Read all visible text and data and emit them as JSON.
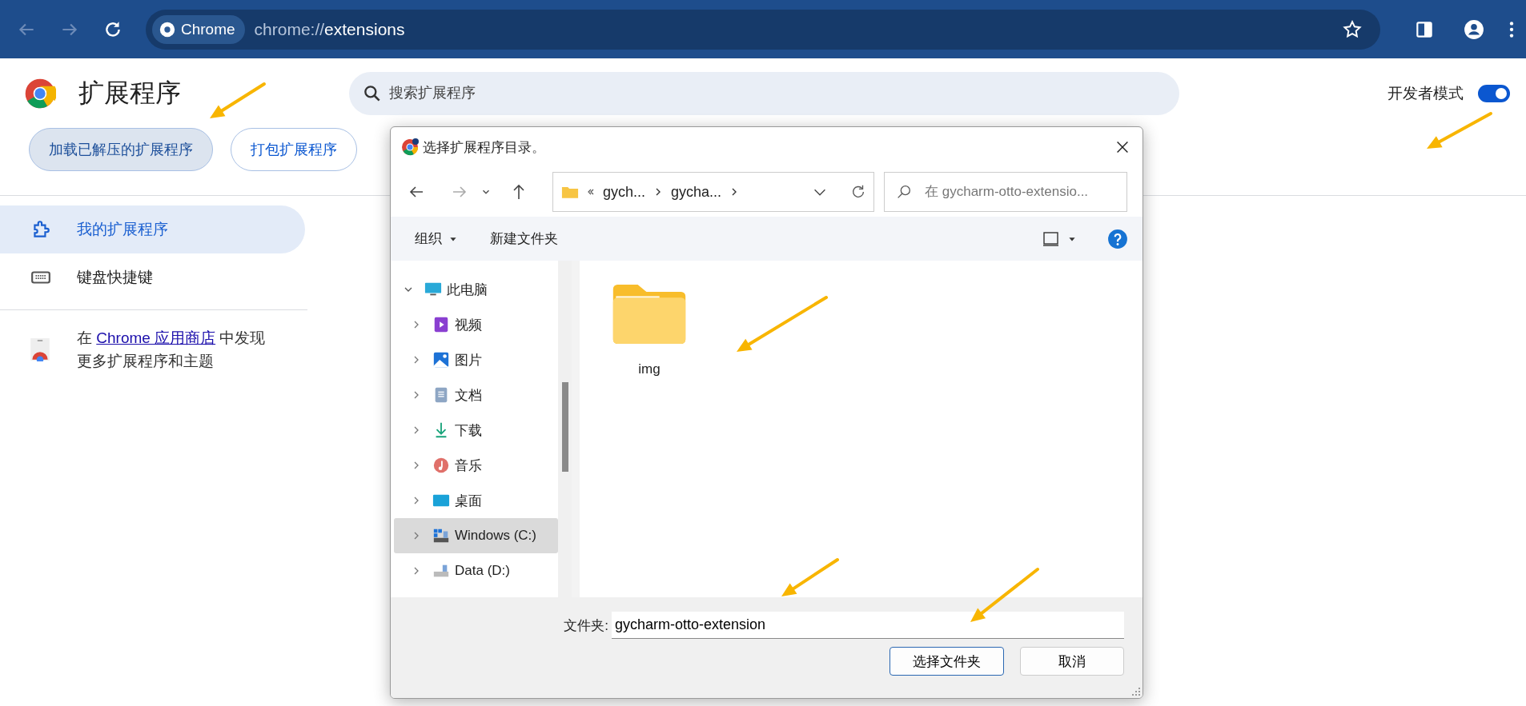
{
  "browser": {
    "back_disabled": true,
    "forward_disabled": true,
    "chip_label": "Chrome",
    "url_scheme": "chrome://",
    "url_path": "extensions"
  },
  "header": {
    "title": "扩展程序",
    "search": {
      "placeholder": "搜索扩展程序"
    },
    "developer_mode": {
      "label": "开发者模式",
      "on": true
    }
  },
  "actions": [
    {
      "label": "加载已解压的扩展程序",
      "highlighted": true
    },
    {
      "label": "打包扩展程序",
      "highlighted": false
    }
  ],
  "sidebar": {
    "items": [
      {
        "label": "我的扩展程序",
        "selected": true
      },
      {
        "label": "键盘快捷键",
        "selected": false
      }
    ],
    "store_promo": {
      "text_before": "在",
      "link": "Chrome 应用商店",
      "text_after": "中发现",
      "line_2": "更多扩展程序和主题"
    }
  },
  "dialog": {
    "title": "选择扩展程序目录。",
    "forward_disabled": true,
    "breadcrumb": [
      "gych...",
      "gycha..."
    ],
    "search": {
      "placeholder": "在 gycharm-otto-extensio..."
    },
    "toolbar": {
      "organize": "组织",
      "new_folder": "新建文件夹"
    },
    "tree": [
      {
        "label": "此电脑",
        "expanded": true,
        "selected": false,
        "children": [
          {
            "label": "视频",
            "expanded": false,
            "selected": false
          },
          {
            "label": "图片",
            "expanded": false,
            "selected": false
          },
          {
            "label": "文档",
            "expanded": false,
            "selected": false
          },
          {
            "label": "下载",
            "expanded": false,
            "selected": false
          },
          {
            "label": "音乐",
            "expanded": false,
            "selected": false
          },
          {
            "label": "桌面",
            "expanded": false,
            "selected": false
          },
          {
            "label": "Windows (C:)",
            "expanded": false,
            "selected": true
          },
          {
            "label": "Data (D:)",
            "expanded": false,
            "selected": false
          }
        ]
      }
    ],
    "files": [
      {
        "name": "img"
      }
    ],
    "folder_label": "文件夹:",
    "folder_value": "gycharm-otto-extension",
    "buttons": [
      {
        "label": "选择文件夹",
        "primary": true
      },
      {
        "label": "取消",
        "primary": false
      }
    ]
  }
}
